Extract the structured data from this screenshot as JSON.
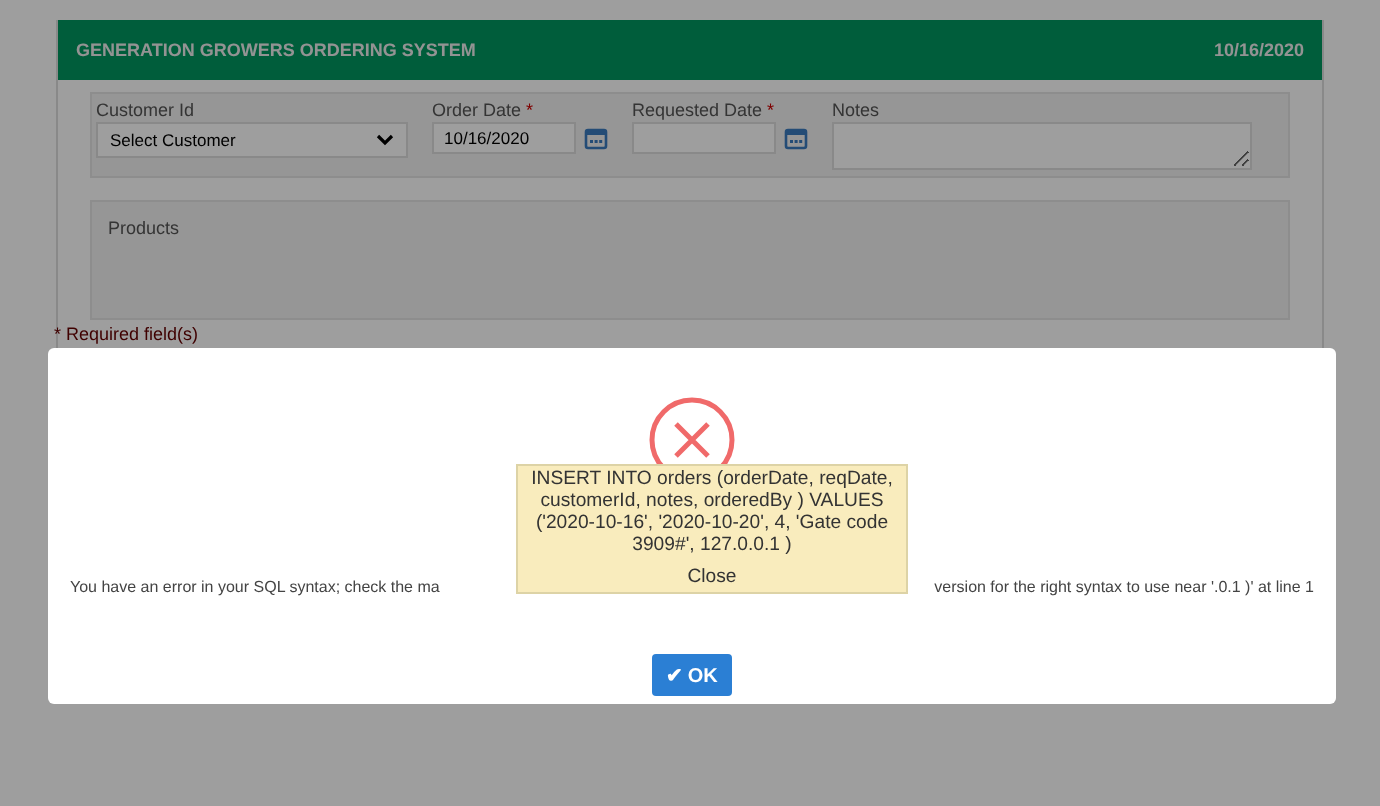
{
  "header": {
    "title": "GENERATION GROWERS ORDERING SYSTEM",
    "date": "10/16/2020"
  },
  "form": {
    "customer": {
      "label": "Customer Id",
      "value": "Select Customer"
    },
    "order_date": {
      "label": "Order Date",
      "required_mark": "*",
      "value": "10/16/2020"
    },
    "requested_date": {
      "label": "Requested Date",
      "required_mark": "*"
    },
    "notes": {
      "label": "Notes"
    }
  },
  "products": {
    "title": "Products"
  },
  "required_note": "* Required field(s)",
  "dialog": {
    "message_left": "You have an error in your SQL syntax; check the ma",
    "message_right": "version for the right syntax to use near '.0.1 )' at line 1",
    "ok_icon": "✔",
    "ok": "OK",
    "tooltip": {
      "text": "INSERT INTO orders (orderDate, reqDate, customerId, notes, orderedBy ) VALUES ('2020-10-16', '2020-10-20', 4, 'Gate code 3909#', 127.0.0.1 )",
      "close": "Close"
    }
  }
}
